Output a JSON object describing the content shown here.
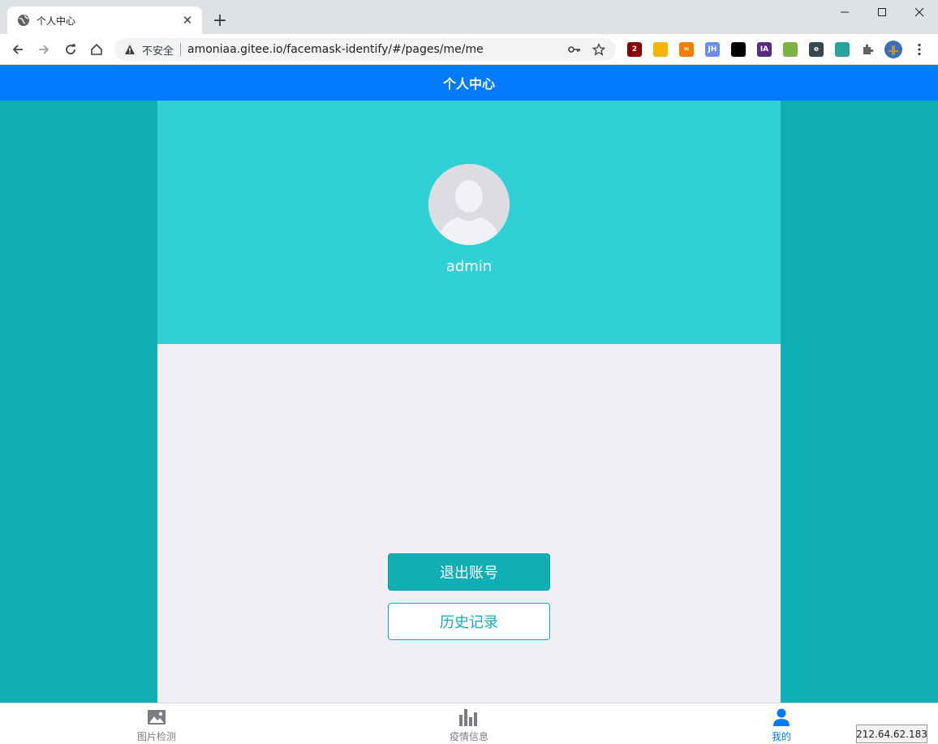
{
  "browser": {
    "tab_title": "个人中心",
    "security_label": "不安全",
    "url": "amoniaa.gitee.io/facemask-identify/#/pages/me/me",
    "extensions": [
      {
        "name": "ublock-icon",
        "color": "#8b0000",
        "text": "2"
      },
      {
        "name": "shield-ext-icon",
        "color": "#f4b400",
        "text": ""
      },
      {
        "name": "infinity-ext-icon",
        "color": "#f57c00",
        "text": "∞"
      },
      {
        "name": "jh-ext-icon",
        "color": "#6a8cf7",
        "text": "JH"
      },
      {
        "name": "tampermonkey-icon",
        "color": "#000000",
        "text": ""
      },
      {
        "name": "ia-ext-icon",
        "color": "#5b2a86",
        "text": "IA"
      },
      {
        "name": "owl-ext-icon",
        "color": "#7cb342",
        "text": ""
      },
      {
        "name": "e-ext-icon",
        "color": "#37474f",
        "text": "e"
      },
      {
        "name": "eyedropper-ext-icon",
        "color": "#26a69a",
        "text": ""
      }
    ]
  },
  "page": {
    "nav_title": "个人中心",
    "username": "admin",
    "buttons": {
      "logout": "退出账号",
      "history": "历史记录"
    },
    "tabbar": [
      {
        "label": "图片检测",
        "icon": "image-icon",
        "active": false
      },
      {
        "label": "疫情信息",
        "icon": "bar-chart-icon",
        "active": false
      },
      {
        "label": "我的",
        "icon": "person-icon",
        "active": true
      }
    ]
  },
  "overlay": {
    "ip_address": "212.64.62.183"
  },
  "colors": {
    "navbar": "#007aff",
    "background": "#10afb5",
    "profile_panel": "#2fd1d7",
    "content": "#efeff4",
    "active_tab": "#007aff"
  }
}
